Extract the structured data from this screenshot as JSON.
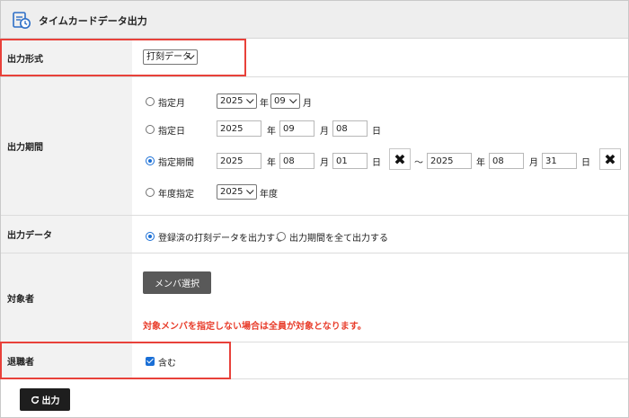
{
  "header": {
    "title": "タイムカードデータ出力",
    "icon": "timecard-icon"
  },
  "output_format": {
    "label": "出力形式",
    "selected": "打刻データ"
  },
  "output_period": {
    "label": "出力期間",
    "month": {
      "label": "指定月",
      "year": "2025",
      "year_unit": "年",
      "month": "09",
      "month_unit": "月",
      "selected": false
    },
    "day": {
      "label": "指定日",
      "year": "2025",
      "year_unit": "年",
      "month": "09",
      "month_unit": "月",
      "day": "08",
      "day_unit": "日",
      "selected": false
    },
    "range": {
      "label": "指定期間",
      "selected": true,
      "from_year": "2025",
      "from_month": "08",
      "from_day": "01",
      "tilde": "～",
      "to_year": "2025",
      "to_month": "08",
      "to_day": "31",
      "year_unit": "年",
      "month_unit": "月",
      "day_unit": "日"
    },
    "fiscal": {
      "label": "年度指定",
      "year": "2025",
      "unit": "年度",
      "selected": false
    }
  },
  "output_data": {
    "label": "出力データ",
    "options": [
      {
        "label": "登録済の打刻データを出力する",
        "selected": true
      },
      {
        "label": "出力期間を全て出力する",
        "selected": false
      }
    ]
  },
  "target": {
    "label": "対象者",
    "button_label": "メンバ選択",
    "warning": "対象メンバを指定しない場合は全員が対象となります。"
  },
  "retired": {
    "label": "退職者",
    "checkbox_label": "含む",
    "checked": true
  },
  "footer": {
    "output_label": "出力",
    "output_icon": "refresh-icon"
  },
  "colors": {
    "highlight": "#e8413a",
    "accent": "#1a6fd6",
    "warning": "#e83c2a",
    "button_dark": "#1e1e1e"
  }
}
